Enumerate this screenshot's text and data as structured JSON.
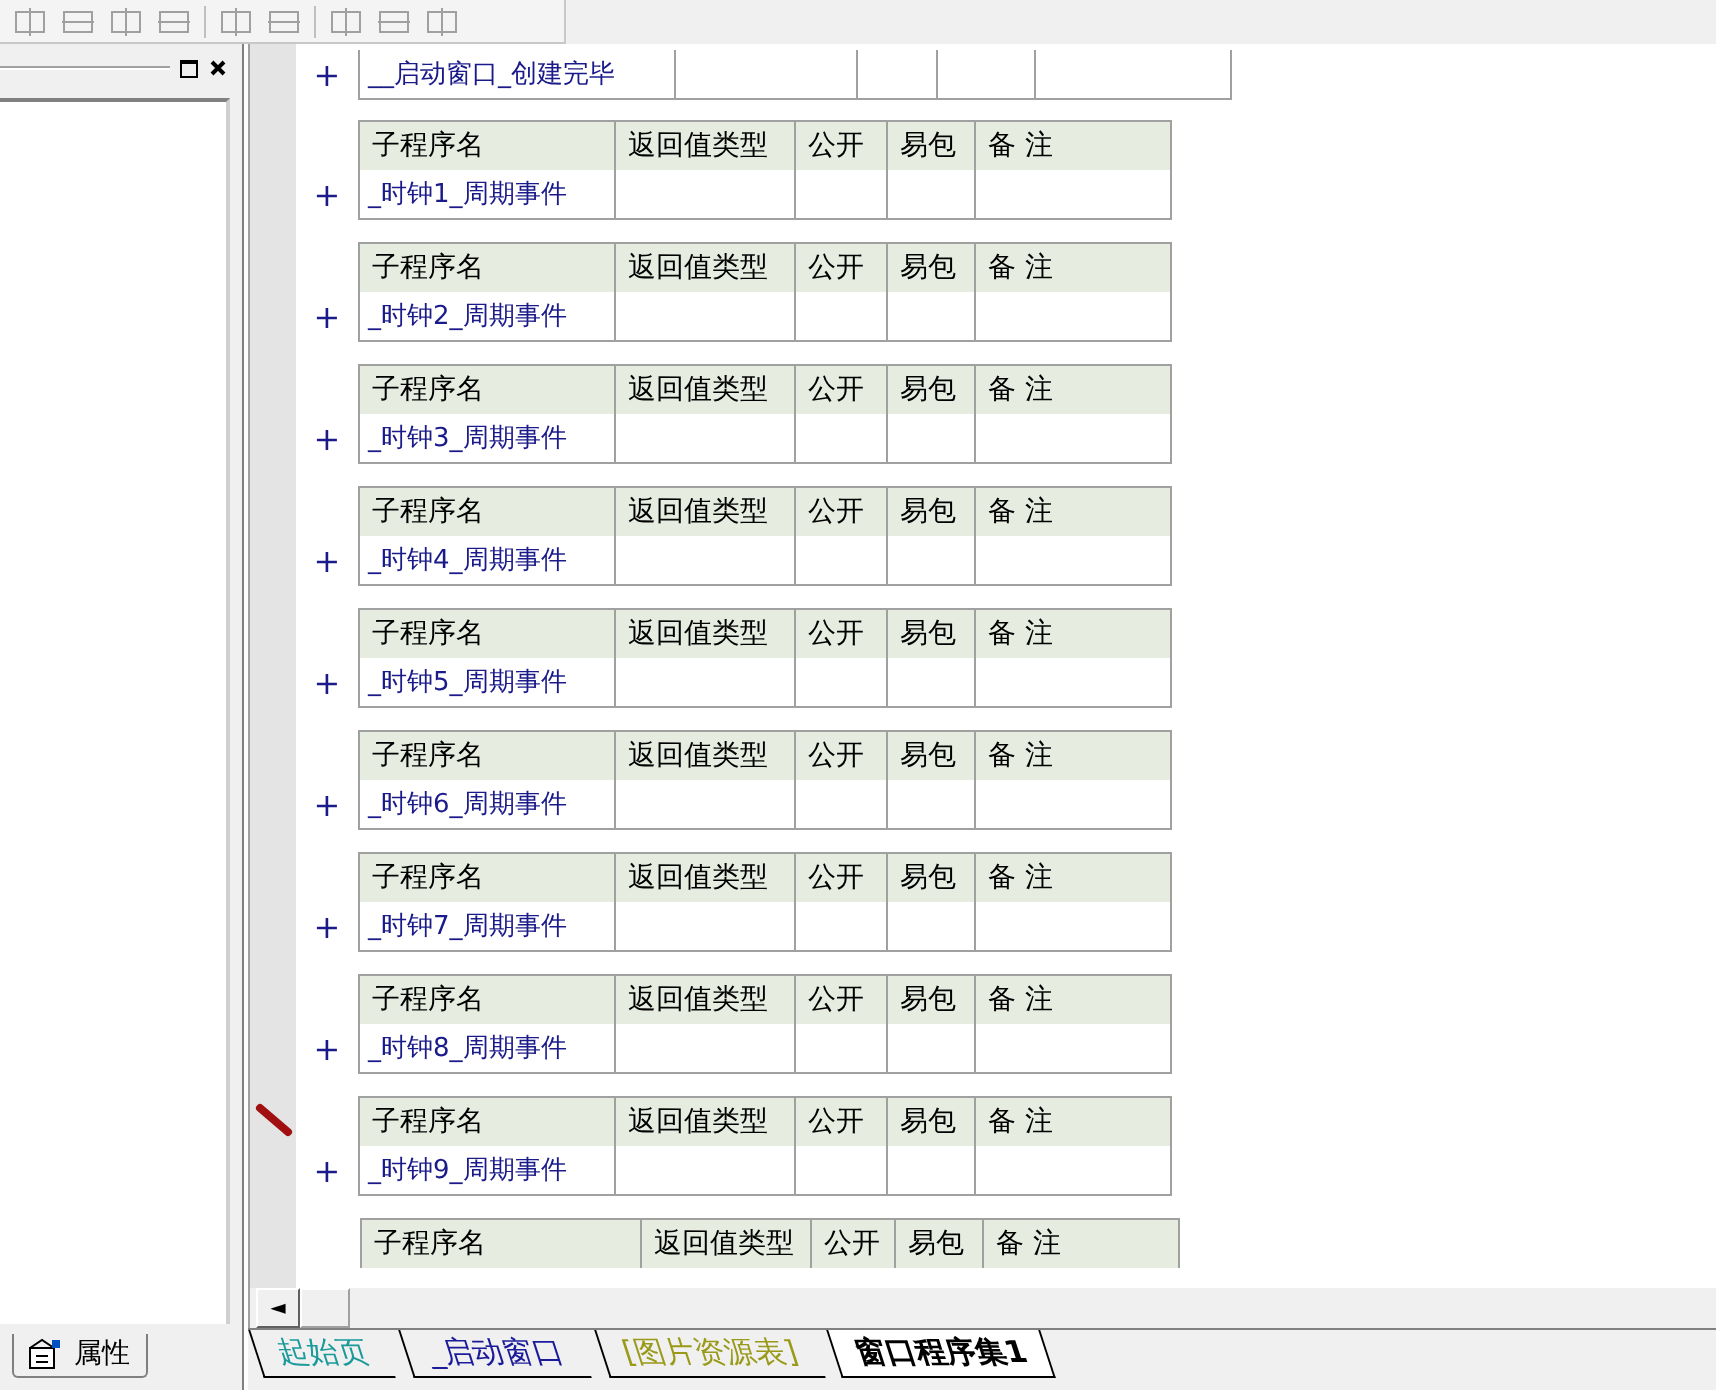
{
  "left_panel": {
    "property_tab": {
      "label": "属性"
    }
  },
  "editor": {
    "first_routine": {
      "expander": "+",
      "name": "__启动窗口_创建完毕"
    },
    "groups": [
      {
        "expander": "+",
        "editing": false,
        "headers": [
          "子程序名",
          "返回值类型",
          "公开",
          "易包",
          "备 注"
        ],
        "name": "_时钟1_周期事件"
      },
      {
        "expander": "+",
        "editing": false,
        "headers": [
          "子程序名",
          "返回值类型",
          "公开",
          "易包",
          "备 注"
        ],
        "name": "_时钟2_周期事件"
      },
      {
        "expander": "+",
        "editing": false,
        "headers": [
          "子程序名",
          "返回值类型",
          "公开",
          "易包",
          "备 注"
        ],
        "name": "_时钟3_周期事件"
      },
      {
        "expander": "+",
        "editing": false,
        "headers": [
          "子程序名",
          "返回值类型",
          "公开",
          "易包",
          "备 注"
        ],
        "name": "_时钟4_周期事件"
      },
      {
        "expander": "+",
        "editing": false,
        "headers": [
          "子程序名",
          "返回值类型",
          "公开",
          "易包",
          "备 注"
        ],
        "name": "_时钟5_周期事件"
      },
      {
        "expander": "+",
        "editing": false,
        "headers": [
          "子程序名",
          "返回值类型",
          "公开",
          "易包",
          "备 注"
        ],
        "name": "_时钟6_周期事件"
      },
      {
        "expander": "+",
        "editing": false,
        "headers": [
          "子程序名",
          "返回值类型",
          "公开",
          "易包",
          "备 注"
        ],
        "name": "_时钟7_周期事件"
      },
      {
        "expander": "+",
        "editing": false,
        "headers": [
          "子程序名",
          "返回值类型",
          "公开",
          "易包",
          "备 注"
        ],
        "name": "_时钟8_周期事件"
      },
      {
        "expander": "+",
        "editing": true,
        "headers": [
          "子程序名",
          "返回值类型",
          "公开",
          "易包",
          "备 注"
        ],
        "name": "_时钟9_周期事件"
      },
      {
        "editing": false,
        "headers": [
          "子程序名",
          "返回值类型",
          "公开",
          "易包",
          "备 注"
        ]
      }
    ]
  },
  "scroll_left": "◄",
  "document_tabs": [
    {
      "label": "起始页",
      "selected": false,
      "color": "#1a9a9a"
    },
    {
      "label": "_启动窗口",
      "selected": false,
      "color": "#1a1a9a"
    },
    {
      "label": "[图片资源表]",
      "selected": false,
      "color": "#9a9a1a"
    },
    {
      "label": "窗口程序集1",
      "selected": true,
      "color": "#000000"
    }
  ]
}
